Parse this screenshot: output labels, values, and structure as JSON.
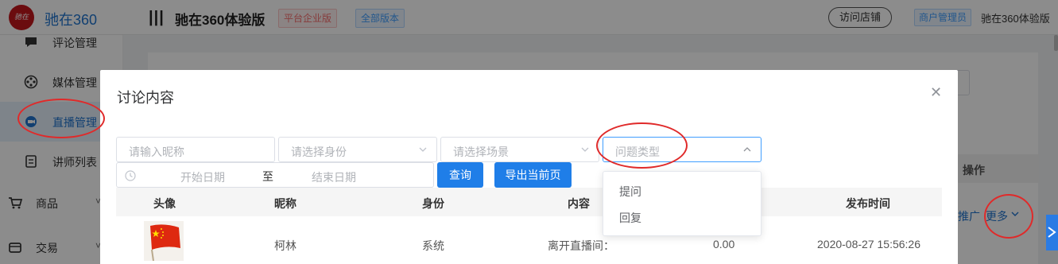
{
  "header": {
    "logo_brand": "驰在360",
    "logo_mark_text": "驰在",
    "app_title": "驰在360体验版",
    "tag_platform": "平台企业版",
    "tag_version": "全部版本",
    "visit_store_label": "访问店铺",
    "role_label": "商户管理员",
    "user_name": "驰在360体验版"
  },
  "sidebar": {
    "items": [
      {
        "label": "评论管理",
        "icon": "comment-icon"
      },
      {
        "label": "媒体管理",
        "icon": "film-reel-icon"
      },
      {
        "label": "直播管理",
        "icon": "live-icon"
      },
      {
        "label": "讲师列表",
        "icon": "document-icon"
      },
      {
        "label": "商品",
        "icon": "cart-icon"
      },
      {
        "label": "交易",
        "icon": "wallet-icon"
      }
    ]
  },
  "background": {
    "column_operation": "操作",
    "link_promote": "推广",
    "link_more": "更多"
  },
  "modal": {
    "title": "讨论内容",
    "filters": {
      "nickname_placeholder": "请输入昵称",
      "identity_placeholder": "请选择身份",
      "scene_placeholder": "请选择场景",
      "question_type_placeholder": "问题类型",
      "start_date_placeholder": "开始日期",
      "date_separator": "至",
      "end_date_placeholder": "结束日期"
    },
    "buttons": {
      "query": "查询",
      "export": "导出当前页"
    },
    "question_type_options": [
      "提问",
      "回复"
    ],
    "table": {
      "columns": [
        "头像",
        "昵称",
        "身份",
        "内容",
        "发布时间"
      ],
      "rows": [
        {
          "nickname": "柯林",
          "identity": "系统",
          "content": "离开直播间：",
          "amount": "0.00",
          "published": "2020-08-27 15:56:26"
        }
      ]
    }
  },
  "colors": {
    "primary": "#1f7ee8",
    "annotation": "#e02a2a",
    "brand_red": "#c4161c"
  }
}
